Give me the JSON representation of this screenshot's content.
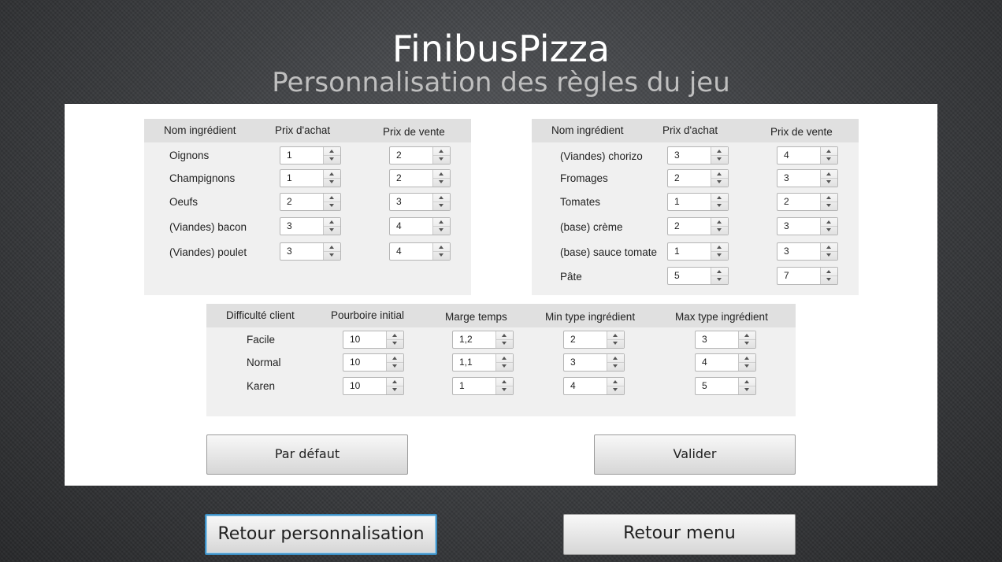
{
  "header": {
    "title": "FinibusPizza",
    "subtitle": "Personnalisation des règles du jeu"
  },
  "left_table": {
    "headers": [
      "Nom ingrédient",
      "Prix d'achat",
      "Prix de vente"
    ],
    "rows": [
      {
        "name": "Oignons",
        "buy": "1",
        "sell": "2"
      },
      {
        "name": "Champignons",
        "buy": "1",
        "sell": "2"
      },
      {
        "name": "Oeufs",
        "buy": "2",
        "sell": "3"
      },
      {
        "name": "(Viandes) bacon",
        "buy": "3",
        "sell": "4"
      },
      {
        "name": "(Viandes) poulet",
        "buy": "3",
        "sell": "4"
      }
    ]
  },
  "right_table": {
    "headers": [
      "Nom ingrédient",
      "Prix d'achat",
      "Prix de vente"
    ],
    "rows": [
      {
        "name": "(Viandes) chorizo",
        "buy": "3",
        "sell": "4"
      },
      {
        "name": "Fromages",
        "buy": "2",
        "sell": "3"
      },
      {
        "name": "Tomates",
        "buy": "1",
        "sell": "2"
      },
      {
        "name": "(base) crème",
        "buy": "2",
        "sell": "3"
      },
      {
        "name": "(base) sauce tomate",
        "buy": "1",
        "sell": "3"
      },
      {
        "name": "Pâte",
        "buy": "5",
        "sell": "7"
      }
    ]
  },
  "difficulty_table": {
    "headers": [
      "Difficulté client",
      "Pourboire initial",
      "Marge temps",
      "Min type ingrédient",
      "Max type ingrédient"
    ],
    "rows": [
      {
        "name": "Facile",
        "tip": "10",
        "margin": "1,2",
        "min": "2",
        "max": "3"
      },
      {
        "name": "Normal",
        "tip": "10",
        "margin": "1,1",
        "min": "3",
        "max": "4"
      },
      {
        "name": "Karen",
        "tip": "10",
        "margin": "1",
        "min": "4",
        "max": "5"
      }
    ]
  },
  "buttons": {
    "default_label": "Par défaut",
    "validate_label": "Valider",
    "back_custom_label": "Retour personnalisation",
    "back_menu_label": "Retour menu"
  }
}
